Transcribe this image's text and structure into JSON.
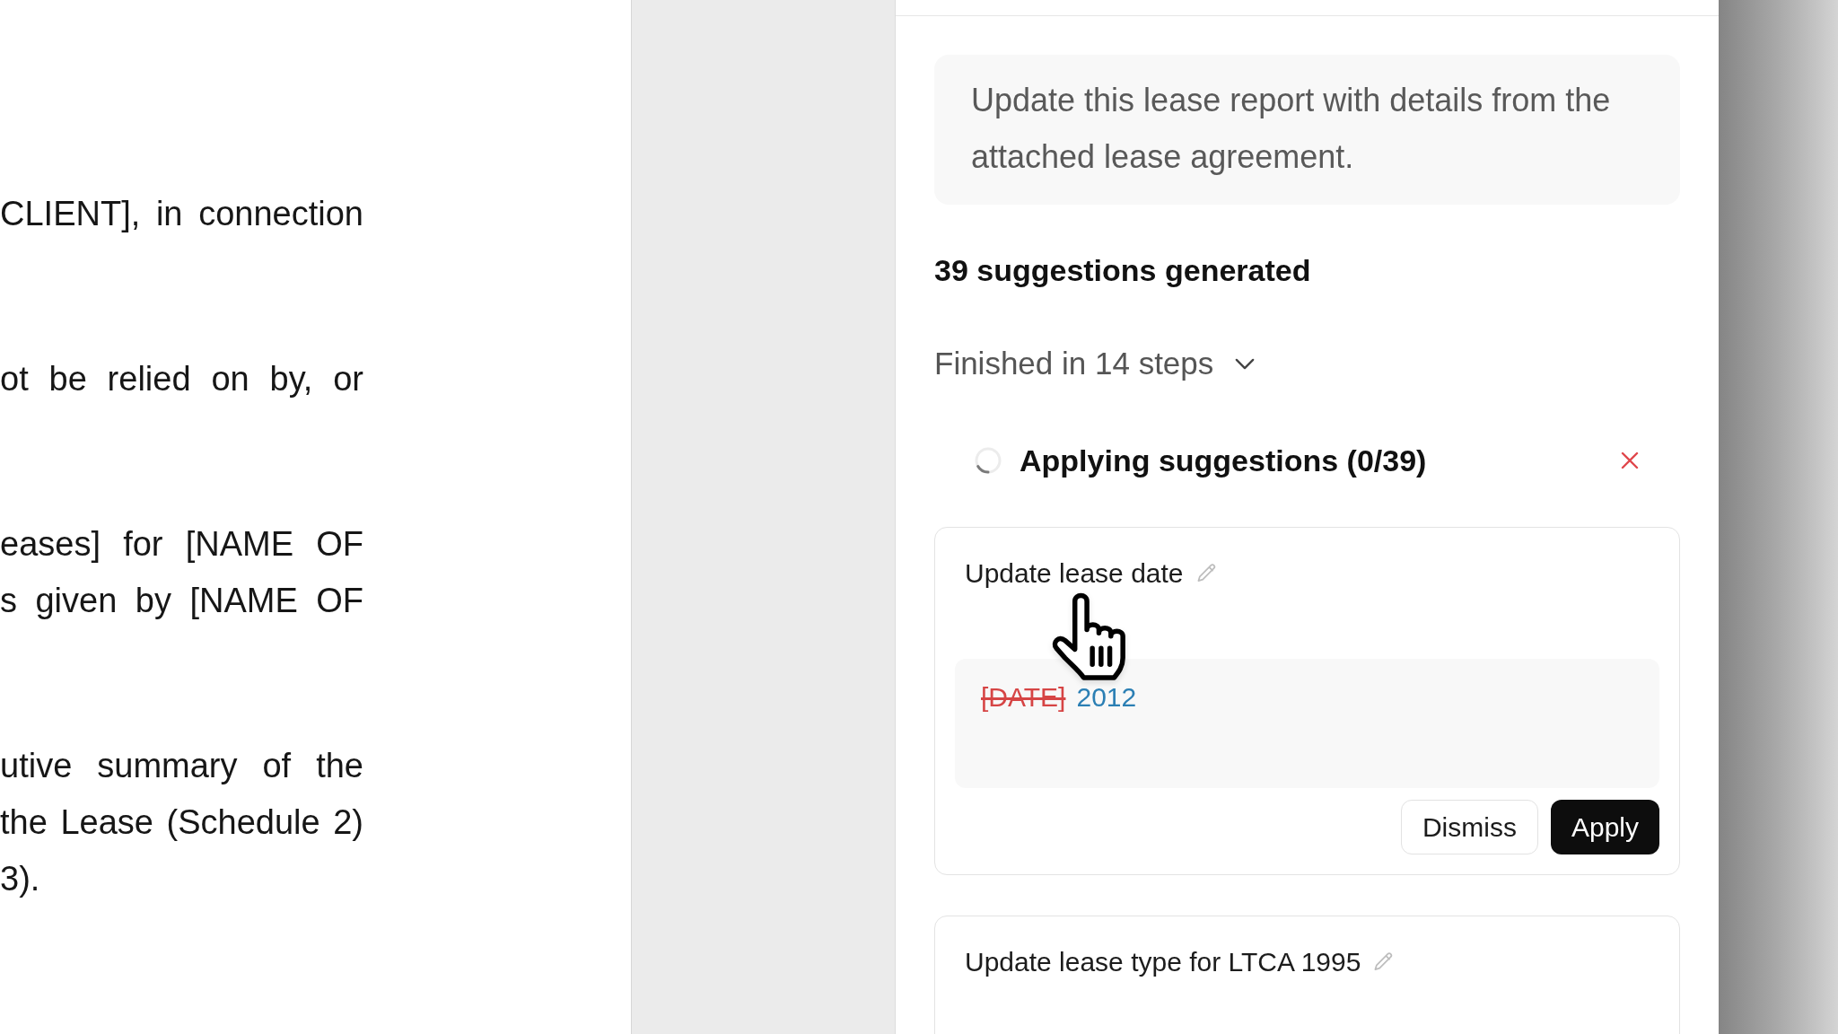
{
  "document": {
    "paragraphs": [
      {
        "lines": [
          {
            "text": "CLIENT], in connection",
            "justified": true
          }
        ]
      },
      {
        "lines": [
          {
            "text": "ot be relied on by, or",
            "justified": true
          }
        ]
      },
      {
        "lines": [
          {
            "text": "eases] for [NAME OF",
            "justified": true
          },
          {
            "text": "s given by [NAME OF",
            "justified": true
          }
        ]
      },
      {
        "lines": [
          {
            "text": "utive summary of the",
            "justified": true
          },
          {
            "text": "the Lease (Schedule 2)",
            "justified": true
          },
          {
            "text": "3).",
            "justified": false
          }
        ]
      }
    ]
  },
  "assistant_panel": {
    "prompt": "Update this lease report with details from the attached lease agreement.",
    "summary": "39 suggestions generated",
    "steps": {
      "label": "Finished in 14 steps",
      "expanded": false
    },
    "progress": {
      "label": "Applying suggestions (0/39)"
    },
    "suggestions": [
      {
        "title": "Update lease date",
        "diff": [
          {
            "kind": "removed",
            "text": "[DATE]"
          },
          {
            "kind": "added",
            "text": "2012"
          }
        ],
        "actions": [
          {
            "kind": "secondary",
            "label": "Dismiss"
          },
          {
            "kind": "primary",
            "label": "Apply"
          }
        ]
      },
      {
        "title": "Update lease type for LTCA 1995"
      }
    ]
  }
}
